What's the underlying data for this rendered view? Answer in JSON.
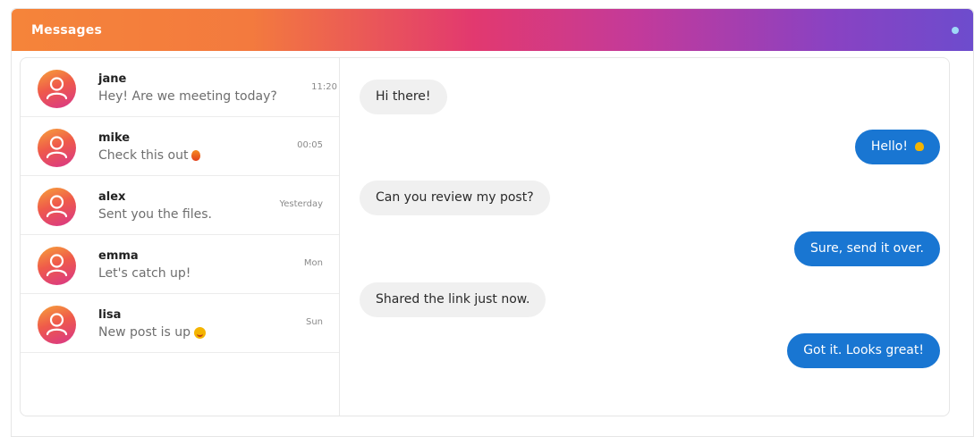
{
  "header": {
    "title": "Messages"
  },
  "colors": {
    "accent_blue": "#1976d2",
    "gradient_start": "#f5843a",
    "gradient_end": "#6d4ccd"
  },
  "conversations": [
    {
      "name": "jane",
      "preview": "Hey! Are we meeting today?",
      "time": "11:20",
      "preview_emoji": ""
    },
    {
      "name": "mike",
      "preview": "Check this out",
      "time": "00:05",
      "preview_emoji": "fire-emoji"
    },
    {
      "name": "alex",
      "preview": "Sent you the files.",
      "time": "Yesterday",
      "preview_emoji": ""
    },
    {
      "name": "emma",
      "preview": "Let's catch up!",
      "time": "Mon",
      "preview_emoji": ""
    },
    {
      "name": "lisa",
      "preview": "New post is up",
      "time": "Sun",
      "preview_emoji": "smile-emoji"
    }
  ],
  "messages": [
    {
      "direction": "incoming",
      "text": "Hi there!"
    },
    {
      "direction": "outgoing",
      "text": "Hello!",
      "emoji": "wave-emoji"
    },
    {
      "direction": "incoming",
      "text": "Can you review my post?"
    },
    {
      "direction": "outgoing",
      "text": "Sure, send it over."
    },
    {
      "direction": "incoming",
      "text": "Shared the link just now."
    },
    {
      "direction": "outgoing",
      "text": "Got it. Looks great!"
    }
  ]
}
